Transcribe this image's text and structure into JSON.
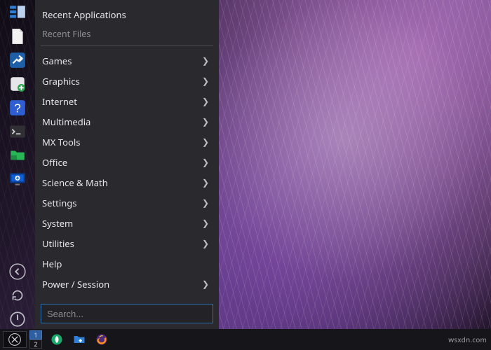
{
  "menu": {
    "recent_apps_label": "Recent Applications",
    "recent_files_label": "Recent Files",
    "categories": [
      {
        "label": "Games"
      },
      {
        "label": "Graphics"
      },
      {
        "label": "Internet"
      },
      {
        "label": "Multimedia"
      },
      {
        "label": "MX Tools"
      },
      {
        "label": "Office"
      },
      {
        "label": "Science & Math"
      },
      {
        "label": "Settings"
      },
      {
        "label": "System"
      },
      {
        "label": "Utilities"
      }
    ],
    "help_label": "Help",
    "power_label": "Power / Session",
    "search_placeholder": "Search..."
  },
  "dock": {
    "items": [
      {
        "name": "window-list-icon"
      },
      {
        "name": "document-icon"
      },
      {
        "name": "tools-icon"
      },
      {
        "name": "add-app-icon"
      },
      {
        "name": "help-icon"
      },
      {
        "name": "terminal-icon"
      },
      {
        "name": "files-icon"
      },
      {
        "name": "system-info-icon"
      }
    ],
    "bottom": [
      {
        "name": "back-icon"
      },
      {
        "name": "refresh-icon"
      },
      {
        "name": "power-icon"
      }
    ]
  },
  "panel": {
    "workspaces": [
      "1",
      "2"
    ],
    "active_workspace": 0,
    "tasks": [
      {
        "name": "updater-icon"
      },
      {
        "name": "file-manager-icon"
      },
      {
        "name": "firefox-icon"
      }
    ],
    "watermark": "wsxdn.com"
  }
}
